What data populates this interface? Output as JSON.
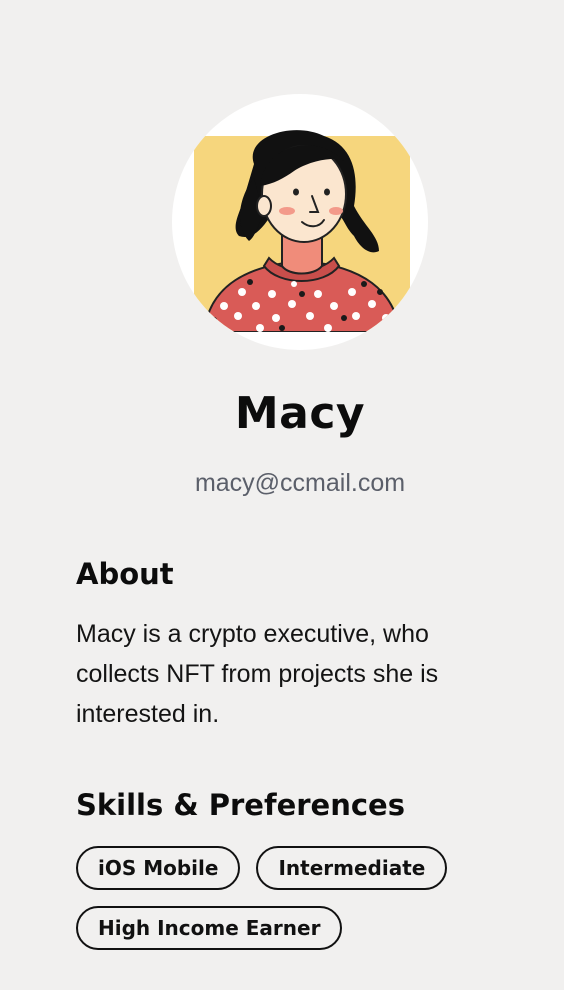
{
  "profile": {
    "name": "Macy",
    "email": "macy@ccmail.com",
    "avatar": "avatar-illustration"
  },
  "about": {
    "title": "About",
    "text": "Macy is a crypto executive, who collects NFT from projects she is interested in."
  },
  "skills": {
    "title": "Skills & Preferences",
    "tags": [
      "iOS Mobile",
      "Intermediate",
      "High Income Earner"
    ]
  },
  "colors": {
    "background": "#f1f0ef",
    "avatar_bg": "#f6d67d",
    "sweater": "#d95b57",
    "text": "#111111",
    "muted": "#5b5f6a"
  }
}
